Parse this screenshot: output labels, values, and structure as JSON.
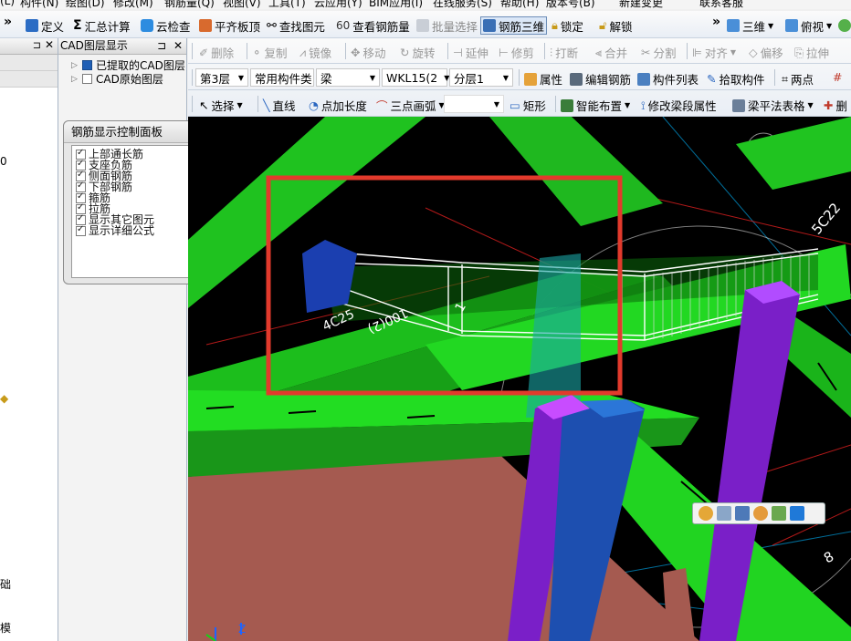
{
  "menubar": {
    "items": [
      "(L)",
      "构件(N)",
      "绘图(D)",
      "修改(M)",
      "钢筋量(Q)",
      "视图(V)",
      "工具(T)",
      "云应用(Y)",
      "BIM应用(I)",
      "在线服务(S)",
      "帮助(H)",
      "版本号(B)",
      "新建变更",
      "联系客服"
    ]
  },
  "toolbar1": {
    "items": [
      {
        "label": "定义",
        "icon": "define-icon"
      },
      {
        "label": "汇总计算",
        "icon": "sigma-icon"
      },
      {
        "label": "云检查",
        "icon": "cloud-check-icon"
      },
      {
        "label": "平齐板顶",
        "icon": "align-slab-icon"
      },
      {
        "label": "查找图元",
        "icon": "binoculars-icon"
      },
      {
        "label": "查看钢筋量",
        "icon": "rebar-view-icon"
      },
      {
        "label": "批量选择",
        "icon": "batch-select-icon"
      },
      {
        "label": "钢筋三维",
        "icon": "rebar-3d-icon"
      },
      {
        "label": "锁定",
        "icon": "lock-icon"
      },
      {
        "label": "解锁",
        "icon": "unlock-icon"
      },
      {
        "label": "三维",
        "icon": "cube-icon"
      },
      {
        "label": "俯视",
        "icon": "top-view-icon"
      }
    ],
    "overflow": "»"
  },
  "left_panel": {
    "labels": [
      "0",
      "础",
      "模"
    ]
  },
  "cad_panel": {
    "title": "CAD图层显示",
    "tree": [
      {
        "label": "已提取的CAD图层",
        "state": "filled"
      },
      {
        "label": "CAD原始图层",
        "state": "empty"
      }
    ]
  },
  "rebar_panel": {
    "title": "钢筋显示控制面板",
    "items": [
      "上部通长筋",
      "支座负筋",
      "侧面钢筋",
      "下部钢筋",
      "箍筋",
      "拉筋",
      "显示其它图元",
      "显示详细公式"
    ]
  },
  "edit_toolbar": {
    "items": [
      "删除",
      "复制",
      "镜像",
      "移动",
      "旋转",
      "延伸",
      "修剪",
      "打断",
      "合并",
      "分割",
      "对齐",
      "偏移",
      "拉伸"
    ]
  },
  "layer_toolbar": {
    "floor": "第3层",
    "category": "常用构件类",
    "type": "梁",
    "element": "WKL15(2",
    "sublayer": "分层1",
    "buttons": [
      "属性",
      "编辑钢筋",
      "构件列表",
      "拾取构件",
      "两点"
    ]
  },
  "draw_toolbar": {
    "select": "选择",
    "items": [
      "直线",
      "点加长度",
      "三点画弧",
      "矩形",
      "智能布置",
      "修改梁段属性",
      "梁平法表格"
    ],
    "last": "删"
  },
  "viewport": {
    "labels": [
      "4C25",
      "100(2)",
      "1",
      "5C22",
      "8"
    ],
    "float_tools": [
      "add-icon",
      "save-icon",
      "monitor-icon",
      "palette-icon",
      "layers-icon",
      "star-icon"
    ]
  },
  "colors": {
    "beam_green": "#22dd22",
    "column_purple": "#7a1fc8",
    "column_blue": "#1d4fb0",
    "slab_brown": "#a55a50",
    "highlight_red": "#e23a2c",
    "toolbar_bg": "#eef2f7"
  }
}
